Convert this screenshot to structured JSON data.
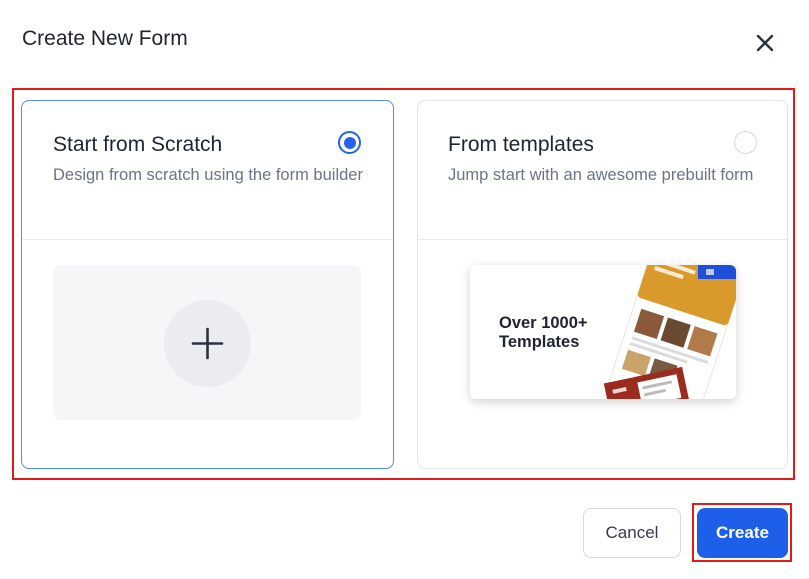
{
  "dialog": {
    "title": "Create New Form",
    "close_icon": "close-icon"
  },
  "options": [
    {
      "title": "Start from Scratch",
      "description": "Design from scratch using the form builder",
      "selected": true,
      "icon": "plus-icon"
    },
    {
      "title": "From templates",
      "description": "Jump start with an awesome prebuilt form",
      "selected": false,
      "preview_line1": "Over 1000+",
      "preview_line2": "Templates"
    }
  ],
  "footer": {
    "cancel_label": "Cancel",
    "create_label": "Create"
  },
  "colors": {
    "accent": "#1d5fe8",
    "selected_border": "#4a8ef0",
    "highlight": "#e01b1b"
  }
}
